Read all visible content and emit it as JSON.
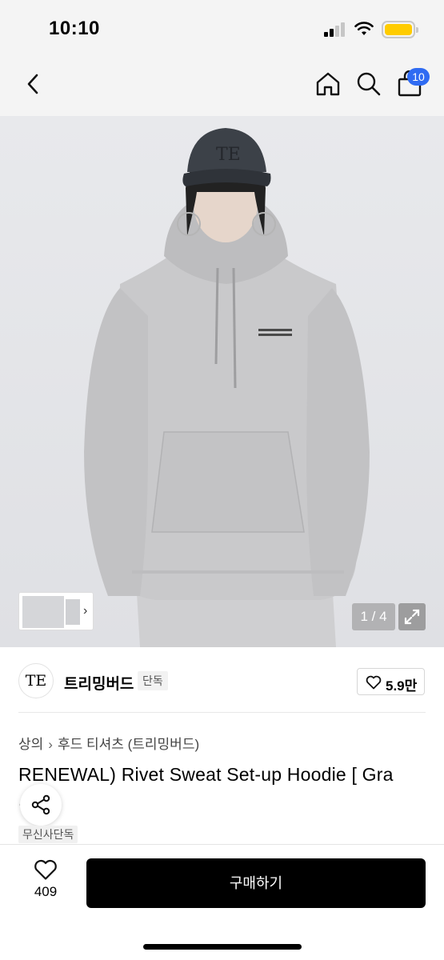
{
  "status": {
    "time": "10:10"
  },
  "header": {
    "cart_count": "10"
  },
  "gallery": {
    "counter": "1 / 4"
  },
  "brand": {
    "logo_text": "TE",
    "name": "트리밍버드",
    "tag": "단독",
    "likes": "5.9만"
  },
  "breadcrumb": {
    "category": "상의",
    "subcategory": "후드 티셔츠 (트리밍버드)"
  },
  "product": {
    "title": "RENEWAL) Rivet Sweat Set-up Hoodie [ Gra",
    "title_cont": "...",
    "exclusive_tag": "무신사단독"
  },
  "bottom_bar": {
    "wish_count": "409",
    "buy_label": "구매하기"
  },
  "colors": {
    "accent": "#2f6bf2",
    "battery": "#ffcc00",
    "buy_button": "#000000"
  }
}
